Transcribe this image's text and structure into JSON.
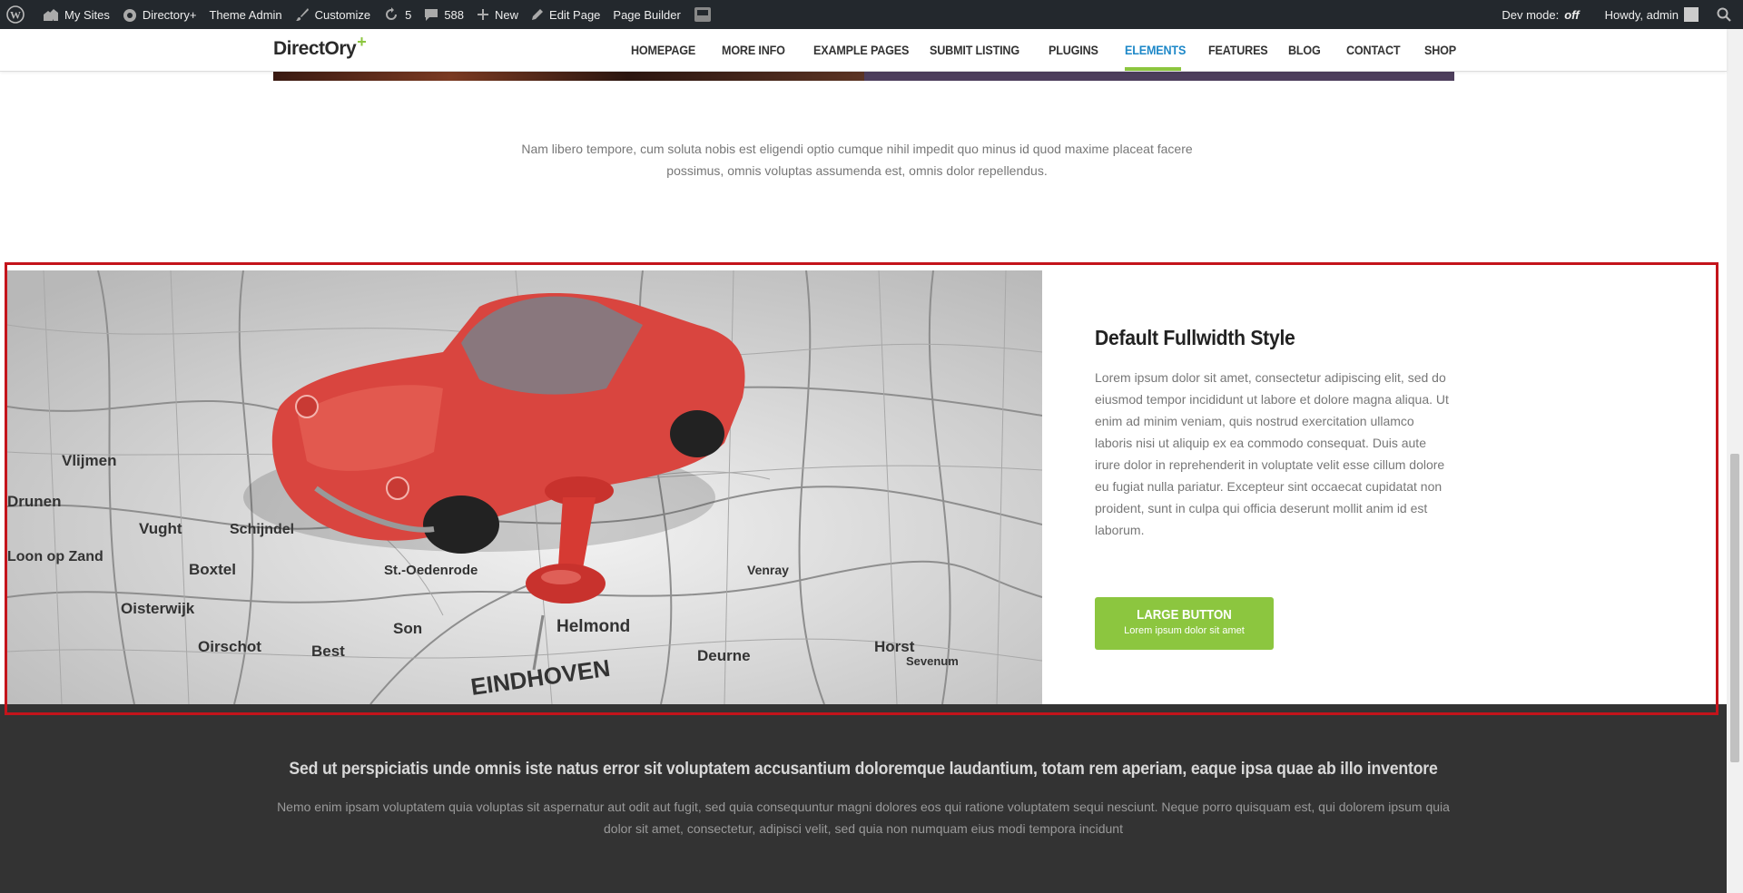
{
  "admin_bar": {
    "my_sites": "My Sites",
    "site_name": "Directory+",
    "theme_admin": "Theme Admin",
    "customize": "Customize",
    "updates_count": "5",
    "comments_count": "588",
    "new": "New",
    "edit_page": "Edit Page",
    "page_builder": "Page Builder",
    "dev_mode_label": "Dev mode:",
    "dev_mode_value": "off",
    "howdy": "Howdy, admin"
  },
  "header": {
    "logo_text": "DirectOry",
    "logo_plus": "+",
    "nav": [
      "HOMEPAGE",
      "MORE INFO",
      "EXAMPLE PAGES",
      "SUBMIT LISTING",
      "PLUGINS",
      "ELEMENTS",
      "FEATURES",
      "BLOG",
      "CONTACT",
      "SHOP"
    ],
    "active_nav": "ELEMENTS"
  },
  "intro_text": "Nam libero tempore, cum soluta nobis est eligendi optio cumque nihil impedit quo minus id quod maxime placeat facere possimus, omnis voluptas assumenda est, omnis dolor repellendus.",
  "fullwidth": {
    "title": "Default Fullwidth Style",
    "body": "Lorem ipsum dolor sit amet, consectetur adipiscing elit, sed do eiusmod tempor incididunt ut labore et dolore magna aliqua. Ut enim ad minim veniam, quis nostrud exercitation ullamco laboris nisi ut aliquip ex ea commodo consequat. Duis aute irure dolor in reprehenderit in voluptate velit esse cillum dolore eu fugiat nulla pariatur. Excepteur sint occaecat cupidatat non proident, sunt in culpa qui officia deserunt mollit anim id est laborum.",
    "button_title": "LARGE BUTTON",
    "button_sub": "Lorem ipsum dolor sit amet",
    "map_labels": [
      "Vlijmen",
      "Drunen",
      "Loon op Zand",
      "Boxtel",
      "Oisterwijk",
      "Oirschot",
      "Best",
      "Son",
      "St.-Oedenrode",
      "Helmond",
      "EINDHOVEN",
      "Deurne",
      "Horst",
      "Sevenum",
      "Venray",
      "Schijndel",
      "Vught"
    ]
  },
  "dark_band": {
    "title": "Sed ut perspiciatis unde omnis iste natus error sit voluptatem accusantium doloremque laudantium, totam rem aperiam, eaque ipsa quae ab illo inventore",
    "body": "Nemo enim ipsam voluptatem quia voluptas sit aspernatur aut odit aut fugit, sed quia consequuntur magni dolores eos qui ratione voluptatem sequi nesciunt. Neque porro quisquam est, qui dolorem ipsum quia dolor sit amet, consectetur, adipisci velit, sed quia non numquam eius modi tempora incidunt"
  },
  "colors": {
    "accent_green": "#8cc63f",
    "nav_active": "#1e88c8",
    "highlight_red": "#c4141b",
    "dark_band": "#333333",
    "admin_bar": "#23282d"
  }
}
